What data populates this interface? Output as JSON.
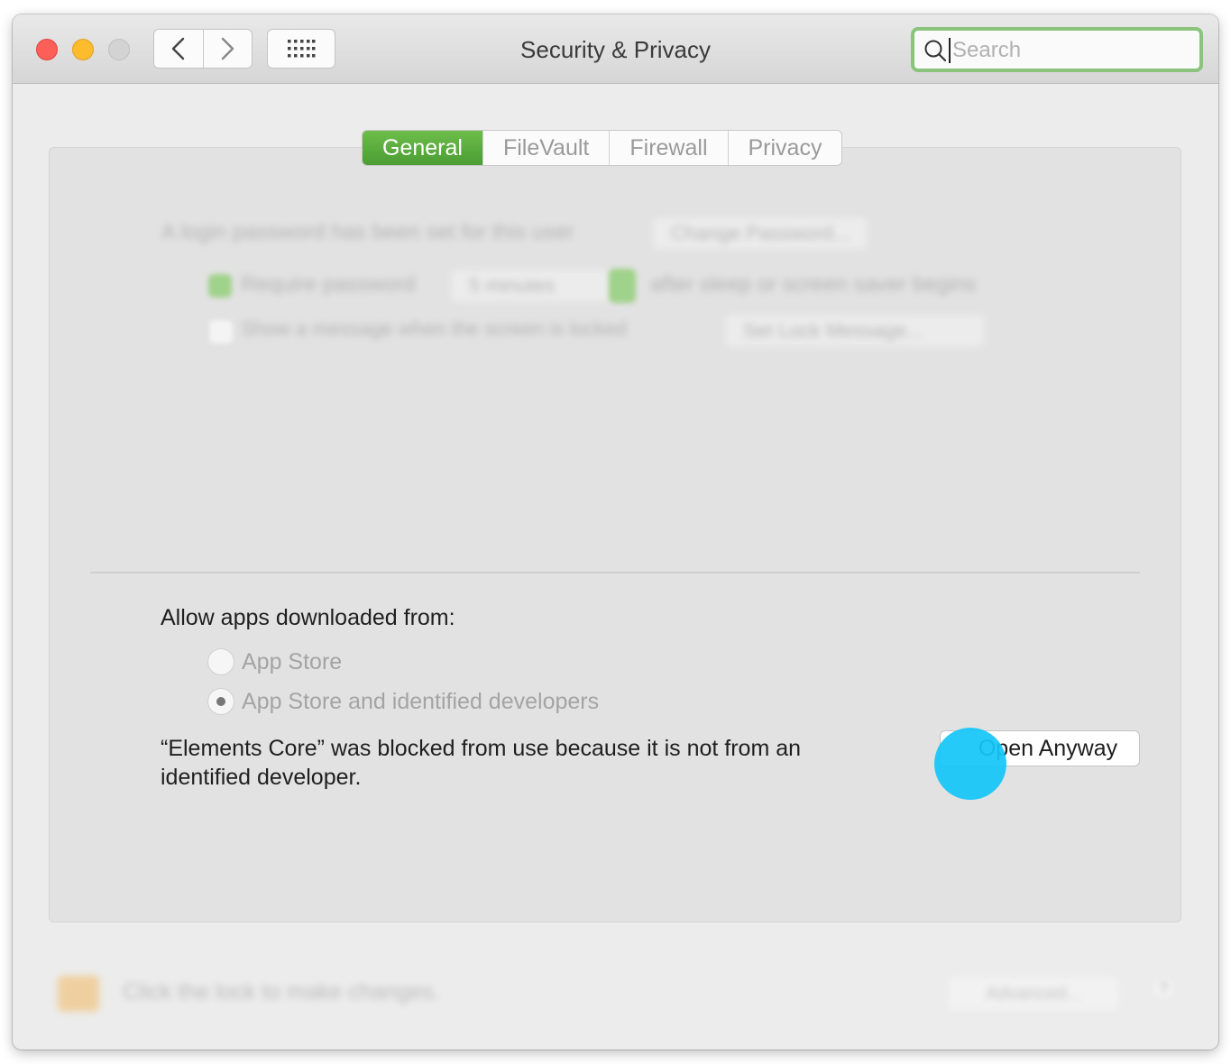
{
  "window": {
    "title": "Security & Privacy"
  },
  "toolbar": {
    "search_placeholder": "Search"
  },
  "tabs": [
    {
      "label": "General",
      "active": true
    },
    {
      "label": "FileVault",
      "active": false
    },
    {
      "label": "Firewall",
      "active": false
    },
    {
      "label": "Privacy",
      "active": false
    }
  ],
  "general": {
    "login_password_text": "A login password has been set for this user",
    "change_password_label": "Change Password...",
    "require_password_label": "Require password",
    "require_password_delay": "5 minutes",
    "require_password_suffix": "after sleep or screen saver begins",
    "show_message_label": "Show a message when the screen is locked",
    "set_lock_message_label": "Set Lock Message..."
  },
  "gatekeeper": {
    "heading": "Allow apps downloaded from:",
    "options": [
      {
        "label": "App Store",
        "selected": false
      },
      {
        "label": "App Store and identified developers",
        "selected": true
      }
    ],
    "blocked_message": "“Elements Core” was blocked from use because it is not from an identified developer.",
    "open_anyway_label": "Open Anyway"
  },
  "footer": {
    "lock_text": "Click the lock to make changes.",
    "advanced_label": "Advanced...",
    "help_label": "?"
  },
  "colors": {
    "accent_tab": "#5aab3d",
    "search_focus_ring": "#8ac47c",
    "tap_indicator": "#16c6f8"
  }
}
